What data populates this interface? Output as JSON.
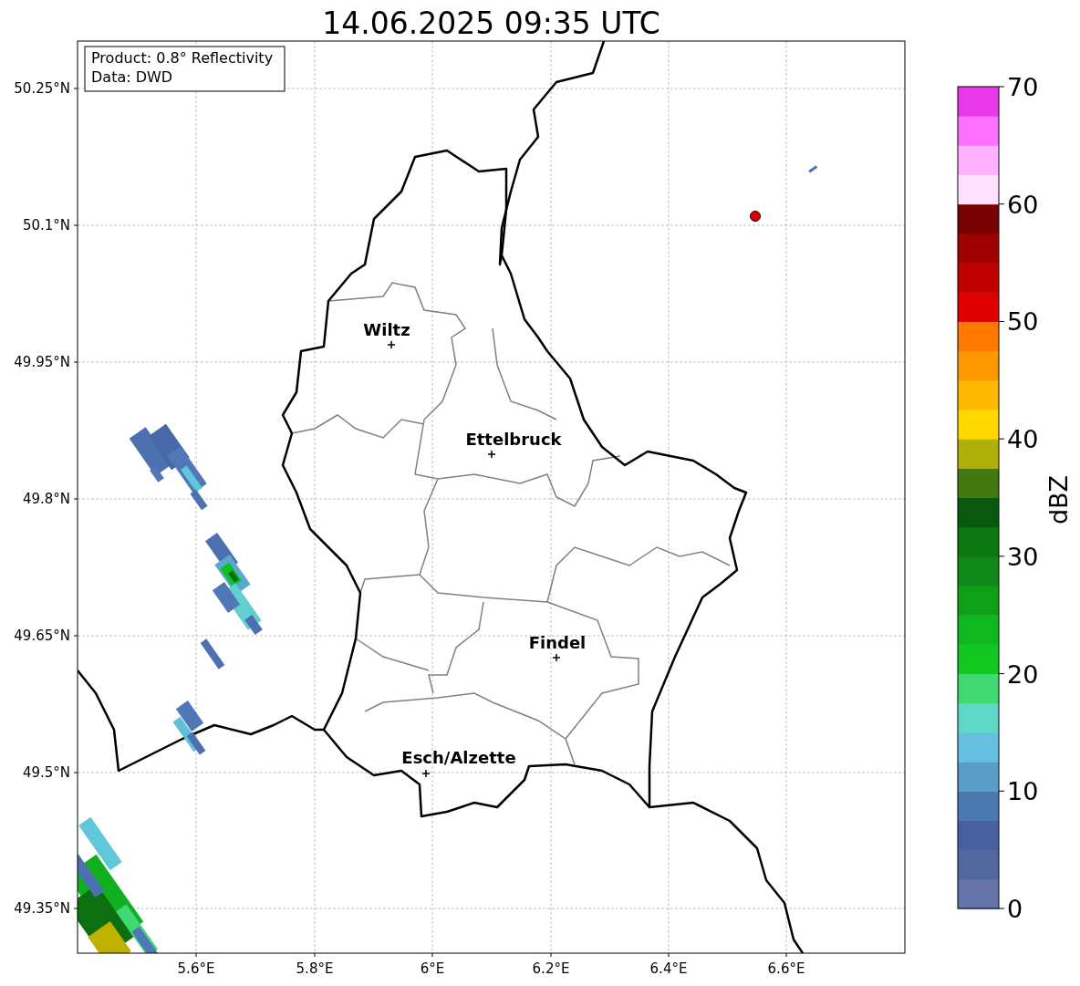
{
  "title": "14.06.2025 09:35 UTC",
  "info_box": {
    "lines": [
      "Product: 0.8° Reflectivity",
      "Data: DWD"
    ]
  },
  "map": {
    "lat_ticks": [
      "50.25°N",
      "50.1°N",
      "49.95°N",
      "49.8°N",
      "49.65°N",
      "49.5°N",
      "49.35°N"
    ],
    "lon_ticks": [
      "5.6°E",
      "5.8°E",
      "6°E",
      "6.2°E",
      "6.4°E",
      "6.6°E"
    ],
    "cities": [
      {
        "name": "Wiltz"
      },
      {
        "name": "Ettelbruck"
      },
      {
        "name": "Findel"
      },
      {
        "name": "Esch/Alzette"
      }
    ]
  },
  "colorbar": {
    "label": "dBZ",
    "ticks": [
      "70",
      "60",
      "50",
      "40",
      "30",
      "20",
      "10",
      "0"
    ],
    "segments": [
      {
        "color": "#6474a8"
      },
      {
        "color": "#5468a0"
      },
      {
        "color": "#4860a0"
      },
      {
        "color": "#4c78b0"
      },
      {
        "color": "#5a9ec8"
      },
      {
        "color": "#66c0e0"
      },
      {
        "color": "#60d8c8"
      },
      {
        "color": "#40d870"
      },
      {
        "color": "#10c820"
      },
      {
        "color": "#10b820"
      },
      {
        "color": "#10a018"
      },
      {
        "color": "#108818"
      },
      {
        "color": "#0c7810"
      },
      {
        "color": "#085810"
      },
      {
        "color": "#447810"
      },
      {
        "color": "#b0b008"
      },
      {
        "color": "#ffd800"
      },
      {
        "color": "#ffb800"
      },
      {
        "color": "#ff9800"
      },
      {
        "color": "#ff7800"
      },
      {
        "color": "#e00000"
      },
      {
        "color": "#c00000"
      },
      {
        "color": "#a00000"
      },
      {
        "color": "#780000"
      },
      {
        "color": "#ffe0ff"
      },
      {
        "color": "#ffb0ff"
      },
      {
        "color": "#ff70ff"
      },
      {
        "color": "#e838e8"
      }
    ]
  }
}
